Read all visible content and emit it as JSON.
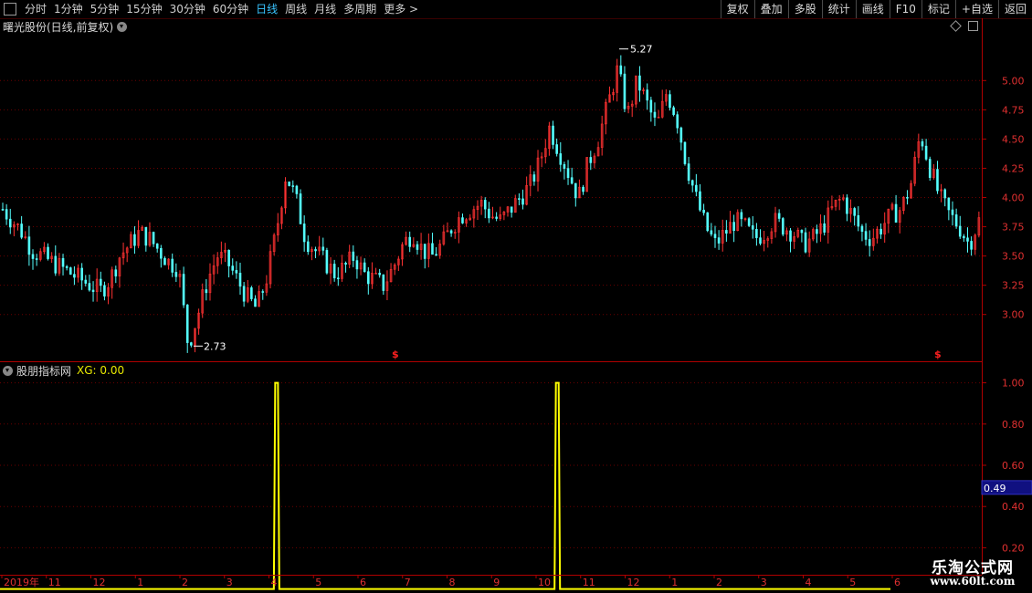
{
  "toolbar": {
    "periods": [
      "分时",
      "1分钟",
      "5分钟",
      "15分钟",
      "30分钟",
      "60分钟",
      "日线",
      "周线",
      "月线",
      "多周期",
      "更多 >"
    ],
    "active_index": 6,
    "buttons": [
      "复权",
      "叠加",
      "多股",
      "统计",
      "画线",
      "F10",
      "标记",
      "+自选",
      "返回"
    ]
  },
  "main_panel": {
    "title": "曙光股份(日线,前复权)"
  },
  "indicator_panel": {
    "name": "股朋指标网",
    "xg_label": "XG: 0.00"
  },
  "logo": {
    "text": "乐淘公式网",
    "url": "www.60lt.com"
  },
  "colors": {
    "up": "#ff3232",
    "down": "#54ffff",
    "indicator": "#ffff00",
    "axis": "#b00000",
    "grid": "#6a0000"
  },
  "chart_data": [
    {
      "type": "candlestick",
      "title": "曙光股份(日线,前复权)",
      "ylim": [
        2.6,
        5.4
      ],
      "y_ticks": [
        "3.00",
        "3.25",
        "3.50",
        "3.75",
        "4.00",
        "4.25",
        "4.50",
        "4.75",
        "5.00"
      ],
      "x_ticks": [
        "2019年",
        "11",
        "12",
        "1",
        "2",
        "3",
        "4",
        "5",
        "6",
        "7",
        "8",
        "9",
        "10",
        "11",
        "12",
        "1",
        "2",
        "3",
        "4",
        "5",
        "6"
      ],
      "annotations": [
        {
          "label": "2.73",
          "value": 2.73
        },
        {
          "label": "5.27",
          "value": 5.27
        }
      ],
      "close_path": [
        3.9,
        3.8,
        3.7,
        3.55,
        3.5,
        3.45,
        3.4,
        3.35,
        3.3,
        3.25,
        3.2,
        3.3,
        3.5,
        3.6,
        3.7,
        3.65,
        3.55,
        3.45,
        3.4,
        2.73,
        3.0,
        3.3,
        3.5,
        3.45,
        3.3,
        3.15,
        3.05,
        3.3,
        3.7,
        4.2,
        4.0,
        3.65,
        3.55,
        3.45,
        3.35,
        3.4,
        3.5,
        3.35,
        3.3,
        3.25,
        3.4,
        3.6,
        3.7,
        3.55,
        3.5,
        3.6,
        3.75,
        3.85,
        3.9,
        3.95,
        3.85,
        3.8,
        3.9,
        4.0,
        4.1,
        4.3,
        4.6,
        4.4,
        4.2,
        4.0,
        4.3,
        4.5,
        4.8,
        5.1,
        4.7,
        5.0,
        4.8,
        4.6,
        4.9,
        4.7,
        4.3,
        4.0,
        3.75,
        3.6,
        3.7,
        3.8,
        3.75,
        3.65,
        3.7,
        3.8,
        3.75,
        3.7,
        3.6,
        3.65,
        3.75,
        3.9,
        4.0,
        3.85,
        3.7,
        3.65,
        3.75,
        3.85,
        3.9,
        4.1,
        4.55,
        4.25,
        4.0,
        3.85,
        3.75,
        3.6,
        3.8
      ]
    },
    {
      "type": "line",
      "series": [
        {
          "name": "XG",
          "values": [
            {
              "x": 0.268,
              "y": 1.0
            },
            {
              "x": 0.54,
              "y": 1.0
            }
          ],
          "baseline": 0.0
        }
      ],
      "ylim": [
        0.1,
        1.1
      ],
      "y_ticks": [
        "0.20",
        "0.40",
        "0.60",
        "0.80",
        "1.00"
      ],
      "current_value": "0.49"
    }
  ],
  "signal_markers": [
    "$",
    "$"
  ]
}
